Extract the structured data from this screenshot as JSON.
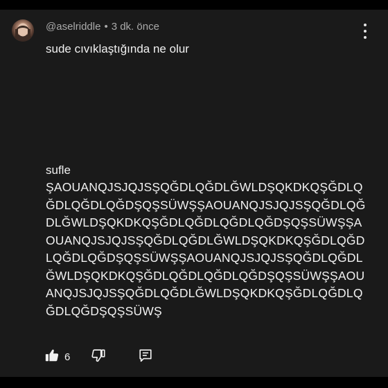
{
  "comment": {
    "author": "@aselriddle",
    "separator": "•",
    "timestamp": "3 dk. önce",
    "line1": "sude cıvıklaştığında ne olur",
    "line2": "sufle",
    "body": "ŞAOUANQJSJQJSŞQĞDLQĞDLĞWLDŞQKDKQŞĞDLQĞDLQĞDLQĞDŞQŞSÜWŞŞAOUANQJSJQJSŞQĞDLQĞDLĞWLDŞQKDKQŞĞDLQĞDLQĞDLQĞDŞQŞSÜWŞŞAOUANQJSJQJSŞQĞDLQĞDLĞWLDŞQKDKQŞĞDLQĞDLQĞDLQĞDŞQŞSÜWŞŞAOUANQJSJQJSŞQĞDLQĞDLĞWLDŞQKDKQŞĞDLQĞDLQĞDLQĞDŞQŞSÜWŞŞAOUANQJSJQJSŞQĞDLQĞDLĞWLDŞQKDKQŞĞDLQĞDLQĞDLQĞDŞQŞSÜWŞ",
    "like_count": "6"
  },
  "icons": {
    "avatar": "avatar",
    "more": "more-vertical-icon",
    "like": "thumbs-up-icon",
    "dislike": "thumbs-down-icon",
    "reply": "reply-comment-icon"
  },
  "colors": {
    "background": "#000000",
    "card": "#1a1a1a",
    "text": "#f1f1f1",
    "meta": "#aaaaaa"
  }
}
